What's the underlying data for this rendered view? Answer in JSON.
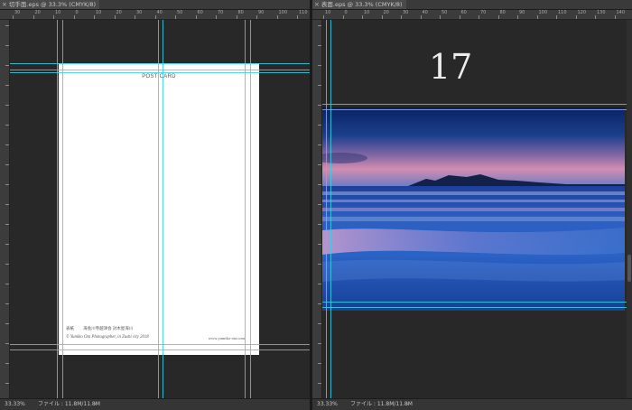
{
  "left_window": {
    "tab_title": "切手面.eps @ 33.3% (CMYK/8)",
    "zoom": "33.33%",
    "file_info": "ファイル : 11.8M/11.8M",
    "ruler_top_labels": [
      "30",
      "20",
      "10",
      "0",
      "10",
      "20",
      "30",
      "40",
      "50",
      "60",
      "70",
      "80",
      "90",
      "100",
      "110"
    ],
    "postcard": {
      "title": "POST CARD",
      "caption": "表紙　　 海会川寺越津会 対木屋海川",
      "copyright": "© Yumiko Ota Photographer, in Zushi city 2018",
      "url": "www.yumiko-ota.com"
    }
  },
  "right_window": {
    "tab_title": "表面.eps @ 33.3% (CMYK/8)",
    "zoom": "33.33%",
    "file_info": "ファイル : 11.8M/11.8M",
    "ruler_top_labels": [
      "10",
      "0",
      "10",
      "20",
      "30",
      "40",
      "50",
      "60",
      "70",
      "80",
      "90",
      "100",
      "110",
      "120",
      "130",
      "140"
    ],
    "page_number": "17"
  },
  "icons": {
    "tab_close": "close-icon",
    "status_arrow": "chevron-right-icon"
  },
  "colors": {
    "guide": "#35d2e6",
    "workspace": "#282828",
    "sky_top": "#0d2a6a",
    "sky_glow": "#c77ea6",
    "sea": "#2f66c4"
  }
}
